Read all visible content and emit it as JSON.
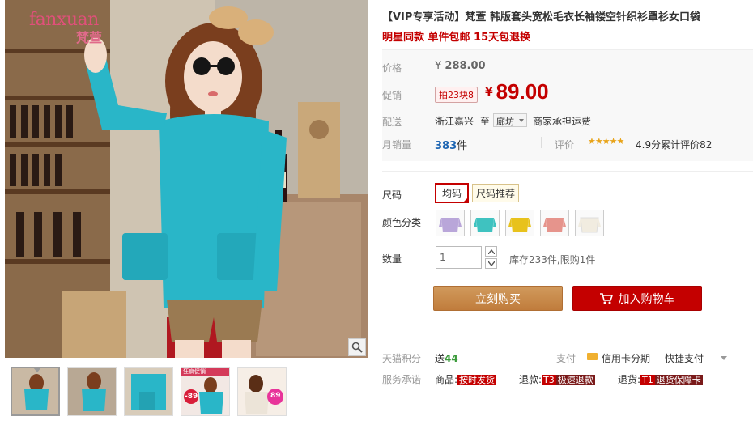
{
  "brand": {
    "logo_text": "fanxuan",
    "logo_cn": "梵萱"
  },
  "gallery": {
    "thumbnail_count": 5,
    "thumbs": [
      {
        "label": ""
      },
      {
        "label": ""
      },
      {
        "label": ""
      },
      {
        "label": "-89",
        "tag": "狂疯促销"
      },
      {
        "label": "89"
      }
    ]
  },
  "product": {
    "title": "【VIP专享活动】梵萱 韩版套头宽松毛衣长袖镂空针织衫罩衫女口袋",
    "subtitle": "明星同款 单件包邮 15天包退换"
  },
  "price": {
    "label": "价格",
    "currency": "¥",
    "original": "288.00",
    "promo_label": "促销",
    "promo_tag": "拍23块8",
    "promo": "89.00"
  },
  "shipping": {
    "label": "配送",
    "from": "浙江嘉兴",
    "to_word": "至",
    "to": "廊坊",
    "fee": "商家承担运费"
  },
  "sales": {
    "label": "月销量",
    "count": "383",
    "unit": "件",
    "review_label": "评价",
    "stars": "★★★★★",
    "rating_text": "4.9分累计评价82",
    "rating": 4.9
  },
  "options": {
    "size_label": "尺码",
    "size_value": "均码",
    "size_guide": "尺码推荐",
    "color_label": "颜色分类",
    "colors": [
      "#b9a6d9",
      "#3fc2c0",
      "#e8c21c",
      "#e6948c",
      "#f1ece0"
    ],
    "qty_label": "数量",
    "qty_value": "1",
    "stock_text": "库存233件,限购1件"
  },
  "buttons": {
    "buy_now": "立刻购买",
    "add_cart": "加入购物车"
  },
  "services": {
    "points_label": "天猫积分",
    "points_prefix": "送",
    "points_value": "44",
    "pay_label": "支付",
    "pay_credit": "信用卡分期",
    "pay_fast": "快捷支付",
    "promise_label": "服务承诺",
    "promise_items": [
      {
        "prefix": "商品:",
        "badge": "按时发货"
      },
      {
        "prefix": "退款:",
        "badge_code": "T3",
        "badge": "极速退款"
      },
      {
        "prefix": "退货:",
        "badge_code": "T1",
        "badge": "退货保障卡"
      }
    ]
  },
  "colors": {
    "accent_red": "#c40000",
    "buy_orange": "#c8884a",
    "link_blue": "#1e66b3"
  },
  "icons": [
    "zoom-icon",
    "cart-icon",
    "chevron-down-icon",
    "card-icon"
  ]
}
